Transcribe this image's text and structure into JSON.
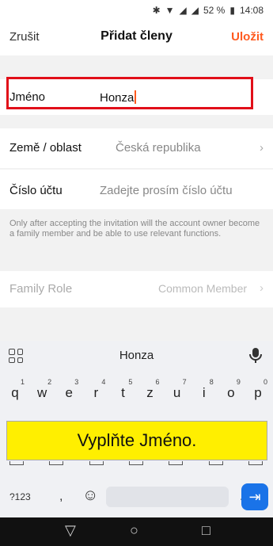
{
  "status": {
    "battery": "52 %",
    "time": "14:08"
  },
  "nav": {
    "cancel": "Zrušit",
    "title": "Přidat členy",
    "save": "Uložit"
  },
  "form": {
    "name_label": "Jméno",
    "name_value": "Honza",
    "country_label": "Země / oblast",
    "country_value": "Česká republika",
    "account_label": "Číslo účtu",
    "account_placeholder": "Zadejte prosím číslo účtu",
    "hint": "Only after accepting the invitation will the account owner become a family member and be able to use relevant functions.",
    "role_label": "Family Role",
    "role_value": "Common Member"
  },
  "keyboard": {
    "suggestion": "Honza",
    "row1": [
      {
        "k": "q",
        "n": "1"
      },
      {
        "k": "w",
        "n": "2"
      },
      {
        "k": "e",
        "n": "3"
      },
      {
        "k": "r",
        "n": "4"
      },
      {
        "k": "t",
        "n": "5"
      },
      {
        "k": "z",
        "n": "6"
      },
      {
        "k": "u",
        "n": "7"
      },
      {
        "k": "i",
        "n": "8"
      },
      {
        "k": "o",
        "n": "9"
      },
      {
        "k": "p",
        "n": "0"
      }
    ],
    "sym_key": "?123",
    "comma": ",",
    "dot": "."
  },
  "banner": {
    "text": "Vyplňte Jméno."
  },
  "colors": {
    "accent": "#ff5a1f",
    "highlight": "#e10f19",
    "banner": "#ffef00",
    "enter": "#1a73e8"
  }
}
